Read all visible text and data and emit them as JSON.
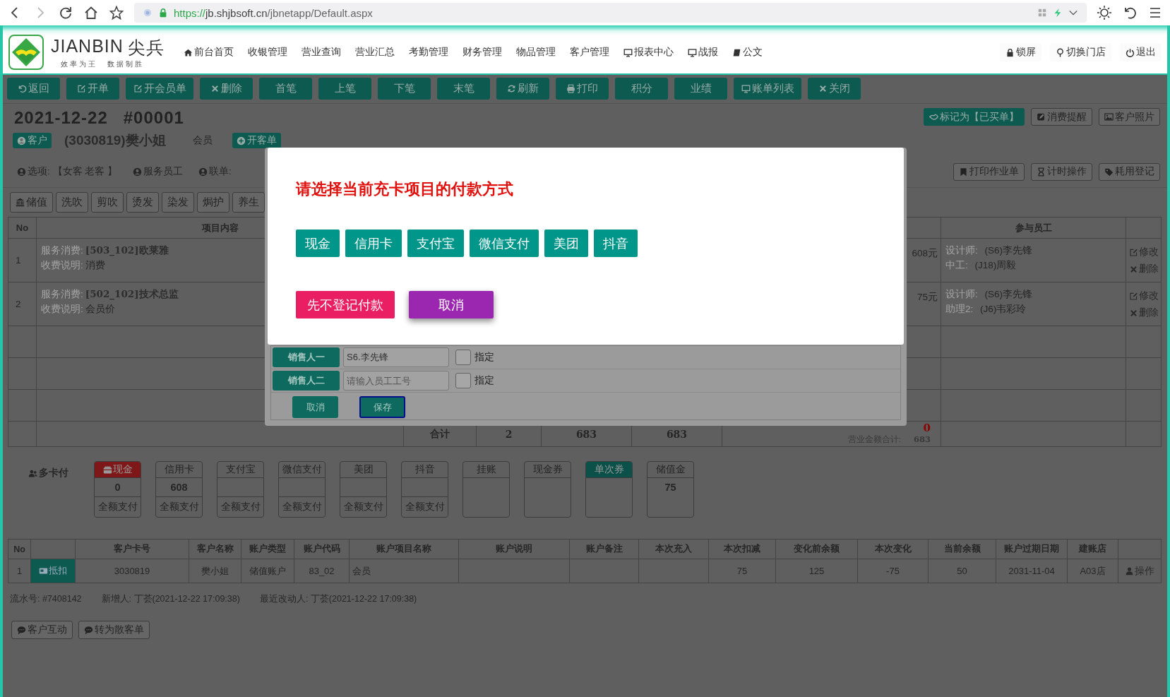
{
  "browser": {
    "url_scheme": "https://",
    "url_host": "jb.shjbsoft.cn",
    "url_path": "/jbnetapp/Default.aspx"
  },
  "brand": {
    "name": "JIANBIN",
    "name_cn": "尖兵",
    "slogan_1": "效率为王",
    "slogan_2": "数据制胜"
  },
  "nav": [
    {
      "label": "前台首页",
      "kind": "home"
    },
    {
      "label": "收银管理",
      "kind": "plain"
    },
    {
      "label": "营业查询",
      "kind": "plain"
    },
    {
      "label": "营业汇总",
      "kind": "plain"
    },
    {
      "label": "考勤管理",
      "kind": "plain"
    },
    {
      "label": "财务管理",
      "kind": "plain"
    },
    {
      "label": "物品管理",
      "kind": "plain"
    },
    {
      "label": "客户管理",
      "kind": "plain"
    },
    {
      "label": "报表中心",
      "kind": "monitor"
    },
    {
      "label": "战报",
      "kind": "monitor"
    },
    {
      "label": "公文",
      "kind": "book"
    }
  ],
  "header_actions": [
    {
      "label": "锁屏",
      "kind": "lock"
    },
    {
      "label": "切换门店",
      "kind": "pin"
    },
    {
      "label": "退出",
      "kind": "power"
    }
  ],
  "toolbar": [
    {
      "label": "返回",
      "kind": "back"
    },
    {
      "label": "开单",
      "kind": "edit"
    },
    {
      "label": "开会员单",
      "kind": "edit"
    },
    {
      "label": "删除",
      "kind": "delete"
    },
    {
      "label": "首笔",
      "kind": "plain"
    },
    {
      "label": "上笔",
      "kind": "plain"
    },
    {
      "label": "下笔",
      "kind": "plain"
    },
    {
      "label": "末笔",
      "kind": "plain"
    },
    {
      "label": "刷新",
      "kind": "refresh"
    },
    {
      "label": "打印",
      "kind": "print"
    },
    {
      "label": "积分",
      "kind": "plain"
    },
    {
      "label": "业绩",
      "kind": "plain"
    },
    {
      "label": "账单列表",
      "kind": "monitor"
    },
    {
      "label": "关闭",
      "kind": "delete"
    }
  ],
  "order": {
    "date": "2021-12-22",
    "number": "#00001"
  },
  "top_actions": [
    {
      "label": "标记为【已买单】",
      "kind": "hand",
      "primary": true
    },
    {
      "label": "消费提醒",
      "kind": "note",
      "primary": false
    },
    {
      "label": "客户照片",
      "kind": "image",
      "primary": false
    }
  ],
  "customer": {
    "button": "客户",
    "name": "(3030819)樊小姐",
    "type": "会员",
    "open_button": "开客单"
  },
  "info": [
    {
      "label": "选项:",
      "value": "【女客 老客 】"
    },
    {
      "label": "服务员工"
    },
    {
      "label": "联单:"
    }
  ],
  "side_actions": [
    {
      "label": "打印作业单",
      "kind": "bookmark"
    },
    {
      "label": "计时操作",
      "kind": "hourglass"
    },
    {
      "label": "耗用登记",
      "kind": "tag"
    }
  ],
  "categories": [
    {
      "label": "储值",
      "kind": "bank"
    },
    {
      "label": "洗吹",
      "kind": "plain"
    },
    {
      "label": "剪吹",
      "kind": "plain"
    },
    {
      "label": "烫发",
      "kind": "plain"
    },
    {
      "label": "染发",
      "kind": "plain"
    },
    {
      "label": "焗护",
      "kind": "plain"
    },
    {
      "label": "养生",
      "kind": "plain"
    }
  ],
  "items_table": {
    "columns": [
      "No",
      "项目内容",
      "参与员工"
    ],
    "rows": [
      {
        "no": "1",
        "service_label": "服务消费:",
        "service": "[503_102]欧莱雅",
        "note_label": "收费说明:",
        "note": "消费",
        "amount": "608元",
        "staff": [
          {
            "role": "设计师:",
            "name": "(S6)李先锋"
          },
          {
            "role": "中工:",
            "name": "(J18)周毅"
          }
        ],
        "actions": [
          "修改",
          "删除"
        ]
      },
      {
        "no": "2",
        "service_label": "服务消费:",
        "service": "[502_102]技术总监",
        "note_label": "收费说明:",
        "note": "会员价",
        "amount": "75元",
        "staff": [
          {
            "role": "设计师:",
            "name": "(S6)李先锋"
          },
          {
            "role": "助理2:",
            "name": "(J6)韦彩玲"
          }
        ],
        "actions": [
          "修改",
          "删除"
        ]
      }
    ],
    "total": {
      "label": "合计",
      "count": "2",
      "sum_1": "683",
      "sum_2": "683",
      "unpaid": "0",
      "revenue_label": "营业金额合计:",
      "revenue": "683"
    }
  },
  "multi_pay": {
    "label": "多卡付",
    "cards": [
      {
        "label": "现金",
        "kind": "cash",
        "color": "#7e1818",
        "value": "0",
        "action": "全额支付"
      },
      {
        "label": "信用卡",
        "kind": "plain",
        "value": "608",
        "action": "全额支付"
      },
      {
        "label": "支付宝",
        "kind": "plain",
        "action": "全额支付"
      },
      {
        "label": "微信支付",
        "kind": "plain",
        "action": "全额支付"
      },
      {
        "label": "美团",
        "kind": "plain",
        "action": "全额支付"
      },
      {
        "label": "抖音",
        "kind": "plain",
        "action": "全额支付"
      },
      {
        "label": "挂账",
        "kind": "plain"
      },
      {
        "label": "现金券",
        "kind": "plain"
      },
      {
        "label": "单次券",
        "kind": "plain",
        "color": "#0b5049"
      },
      {
        "label": "储值金",
        "kind": "plain",
        "value": "75"
      }
    ]
  },
  "accounts_table": {
    "columns": [
      "No",
      "",
      "客户卡号",
      "客户名称",
      "账户类型",
      "账户代码",
      "账户项目名称",
      "账户说明",
      "账户备注",
      "本次充入",
      "本次扣减",
      "变化前余额",
      "本次变化",
      "当前余额",
      "账户过期日期",
      "建账店",
      ""
    ],
    "rows": [
      {
        "cells": [
          "1",
          "抵扣",
          "3030819",
          "樊小姐",
          "储值账户",
          "83_02",
          "会员",
          "",
          "",
          "",
          "75",
          "125",
          "-75",
          "50",
          "2031-11-04",
          "A03店",
          "操作"
        ]
      }
    ]
  },
  "footer": {
    "serial": "流水号: #7408142",
    "created": "新增人: 丁荟(2021-12-22 17:09:38)",
    "modified": "最近改动人: 丁荟(2021-12-22 17:09:38)"
  },
  "bottom_actions": [
    {
      "label": "客户互动"
    },
    {
      "label": "转为散客单"
    }
  ],
  "sales_dialog": {
    "rows": [
      {
        "label": "销售人一",
        "value": "S6.李先锋",
        "checked": false,
        "option": "指定"
      },
      {
        "label": "销售人二",
        "placeholder": "请输入员工工号",
        "checked": false,
        "option": "指定"
      }
    ],
    "buttons": [
      {
        "label": "取消",
        "focused": false
      },
      {
        "label": "保存",
        "focused": true
      }
    ]
  },
  "payment_dialog": {
    "title": "请选择当前充卡项目的付款方式",
    "methods": [
      "现金",
      "信用卡",
      "支付宝",
      "微信支付",
      "美团",
      "抖音"
    ],
    "actions": [
      {
        "label": "先不登记付款",
        "kind": "skip"
      },
      {
        "label": "取消",
        "kind": "cancel"
      }
    ]
  }
}
